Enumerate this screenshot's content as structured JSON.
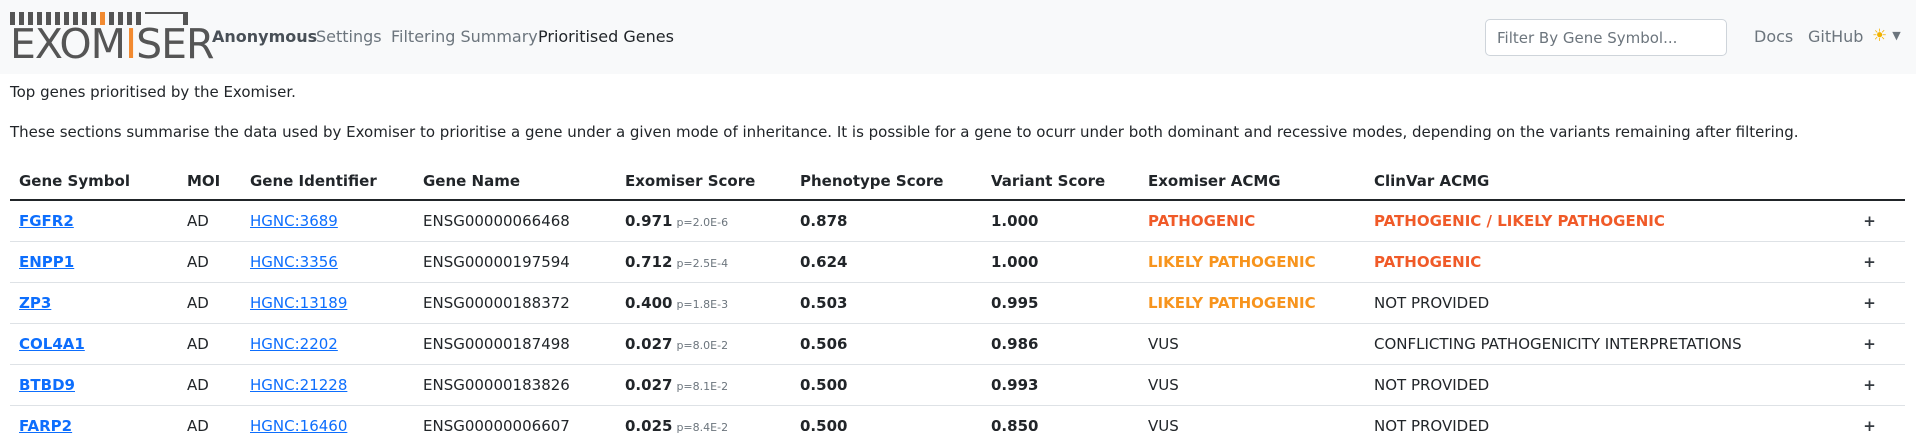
{
  "navbar": {
    "logo_text_pre": "EXOM",
    "logo_text_i": "I",
    "logo_text_post": "SER",
    "brand_label": "Anonymous",
    "links": {
      "settings": "Settings",
      "filtering_summary": "Filtering Summary",
      "prioritised_genes": "Prioritised Genes",
      "docs": "Docs",
      "github": "GitHub"
    },
    "search_placeholder": "Filter By Gene Symbol...",
    "theme_icon": "☀",
    "colors": {
      "accent": "#f28a30",
      "background": "#f8f9fa"
    }
  },
  "intro_text": "Top genes prioritised by the Exomiser.",
  "summary_text": "These sections summarise the data used by Exomiser to prioritise a gene under a given mode of inheritance. It is possible for a gene to ocurr under both dominant and recessive modes, depending on the variants remaining after filtering.",
  "table": {
    "headers": [
      "Gene Symbol",
      "MOI",
      "Gene Identifier",
      "Gene Name",
      "Exomiser Score",
      "Phenotype Score",
      "Variant Score",
      "Exomiser ACMG",
      "ClinVar ACMG"
    ],
    "rows": [
      {
        "symbol": "FGFR2",
        "moi": "AD",
        "identifier": "HGNC:3689",
        "name": "ENSG00000066468",
        "exomiser_score": "0.971",
        "p": "p=2.0E-6",
        "phenotype": "0.878",
        "variant": "1.000",
        "exomiser_acmg": "PATHOGENIC",
        "exomiser_acmg_class": "acmg-pathogenic",
        "clinvar_acmg": "PATHOGENIC / LIKELY PATHOGENIC",
        "clinvar_acmg_class": "acmg-pathogenic"
      },
      {
        "symbol": "ENPP1",
        "moi": "AD",
        "identifier": "HGNC:3356",
        "name": "ENSG00000197594",
        "exomiser_score": "0.712",
        "p": "p=2.5E-4",
        "phenotype": "0.624",
        "variant": "1.000",
        "exomiser_acmg": "LIKELY PATHOGENIC",
        "exomiser_acmg_class": "acmg-likely",
        "clinvar_acmg": "PATHOGENIC",
        "clinvar_acmg_class": "acmg-pathogenic"
      },
      {
        "symbol": "ZP3",
        "moi": "AD",
        "identifier": "HGNC:13189",
        "name": "ENSG00000188372",
        "exomiser_score": "0.400",
        "p": "p=1.8E-3",
        "phenotype": "0.503",
        "variant": "0.995",
        "exomiser_acmg": "LIKELY PATHOGENIC",
        "exomiser_acmg_class": "acmg-likely",
        "clinvar_acmg": "NOT PROVIDED",
        "clinvar_acmg_class": "acmg-plain"
      },
      {
        "symbol": "COL4A1",
        "moi": "AD",
        "identifier": "HGNC:2202",
        "name": "ENSG00000187498",
        "exomiser_score": "0.027",
        "p": "p=8.0E-2",
        "phenotype": "0.506",
        "variant": "0.986",
        "exomiser_acmg": "VUS",
        "exomiser_acmg_class": "acmg-plain",
        "clinvar_acmg": "CONFLICTING PATHOGENICITY INTERPRETATIONS",
        "clinvar_acmg_class": "acmg-plain"
      },
      {
        "symbol": "BTBD9",
        "moi": "AD",
        "identifier": "HGNC:21228",
        "name": "ENSG00000183826",
        "exomiser_score": "0.027",
        "p": "p=8.1E-2",
        "phenotype": "0.500",
        "variant": "0.993",
        "exomiser_acmg": "VUS",
        "exomiser_acmg_class": "acmg-plain",
        "clinvar_acmg": "NOT PROVIDED",
        "clinvar_acmg_class": "acmg-plain"
      },
      {
        "symbol": "FARP2",
        "moi": "AD",
        "identifier": "HGNC:16460",
        "name": "ENSG00000006607",
        "exomiser_score": "0.025",
        "p": "p=8.4E-2",
        "phenotype": "0.500",
        "variant": "0.850",
        "exomiser_acmg": "VUS",
        "exomiser_acmg_class": "acmg-plain",
        "clinvar_acmg": "NOT PROVIDED",
        "clinvar_acmg_class": "acmg-plain"
      }
    ],
    "expand_icon": "plus-icon",
    "colors": {
      "link": "#0d6efd",
      "pathogenic": "#f05a28",
      "likely_pathogenic": "#f7941d"
    }
  }
}
